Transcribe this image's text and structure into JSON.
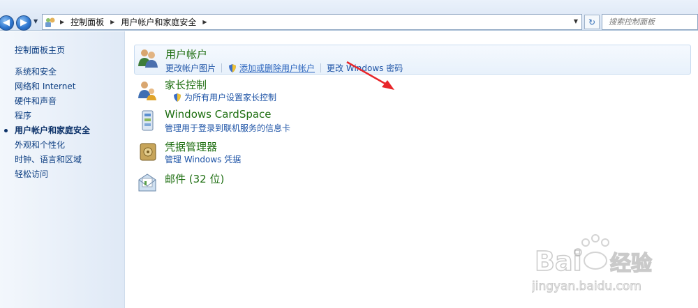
{
  "address_bar": {
    "crumbs": [
      "控制面板",
      "用户帐户和家庭安全"
    ],
    "search_placeholder": "搜索控制面板"
  },
  "sidebar": {
    "home": "控制面板主页",
    "items": [
      {
        "label": "系统和安全",
        "active": false
      },
      {
        "label": "网络和 Internet",
        "active": false
      },
      {
        "label": "硬件和声音",
        "active": false
      },
      {
        "label": "程序",
        "active": false
      },
      {
        "label": "用户帐户和家庭安全",
        "active": true
      },
      {
        "label": "外观和个性化",
        "active": false
      },
      {
        "label": "时钟、语言和区域",
        "active": false
      },
      {
        "label": "轻松访问",
        "active": false
      }
    ]
  },
  "categories": [
    {
      "title": "用户帐户",
      "icon": "users-icon",
      "links": [
        "更改帐户图片",
        "添加或删除用户帐户",
        "更改 Windows 密码"
      ]
    },
    {
      "title": "家长控制",
      "icon": "parental-control-icon",
      "links": [
        "为所有用户设置家长控制"
      ]
    },
    {
      "title": "Windows CardSpace",
      "icon": "cardspace-icon",
      "links": [
        "管理用于登录到联机服务的信息卡"
      ]
    },
    {
      "title": "凭据管理器",
      "icon": "credential-vault-icon",
      "links": [
        "管理 Windows 凭据"
      ]
    },
    {
      "title": "邮件 (32 位)",
      "icon": "mail-icon",
      "links": []
    }
  ],
  "annotation": {
    "color": "#e8262a"
  },
  "colors": {
    "category_title": "#1f6f12",
    "link": "#1d53a6",
    "sidebar_link": "#0a3c80"
  }
}
